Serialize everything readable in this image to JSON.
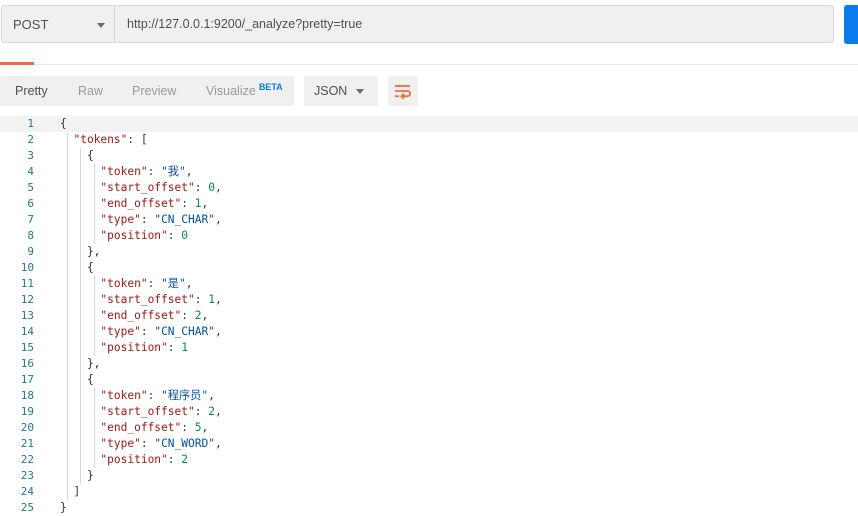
{
  "request": {
    "method": "POST",
    "url": "http://127.0.0.1:9200/_analyze?pretty=true"
  },
  "response": {
    "view_tabs": [
      {
        "label": "Pretty",
        "active": true
      },
      {
        "label": "Raw",
        "active": false
      },
      {
        "label": "Preview",
        "active": false
      },
      {
        "label": "Visualize",
        "active": false,
        "badge": "BETA"
      }
    ],
    "format": "JSON",
    "wrap_icon": "wrap-lines-icon",
    "lines": [
      "{",
      "  \"tokens\": [",
      "    {",
      "      \"token\": \"我\",",
      "      \"start_offset\": 0,",
      "      \"end_offset\": 1,",
      "      \"type\": \"CN_CHAR\",",
      "      \"position\": 0",
      "    },",
      "    {",
      "      \"token\": \"是\",",
      "      \"start_offset\": 1,",
      "      \"end_offset\": 2,",
      "      \"type\": \"CN_CHAR\",",
      "      \"position\": 1",
      "    },",
      "    {",
      "      \"token\": \"程序员\",",
      "      \"start_offset\": 2,",
      "      \"end_offset\": 5,",
      "      \"type\": \"CN_WORD\",",
      "      \"position\": 2",
      "    }",
      "  ]",
      "}"
    ]
  },
  "colors": {
    "accent_orange": "#f26b3a",
    "send_blue": "#097bed",
    "key": "#a31515",
    "string": "#0451a5",
    "number": "#098658",
    "line_number": "#237893"
  }
}
